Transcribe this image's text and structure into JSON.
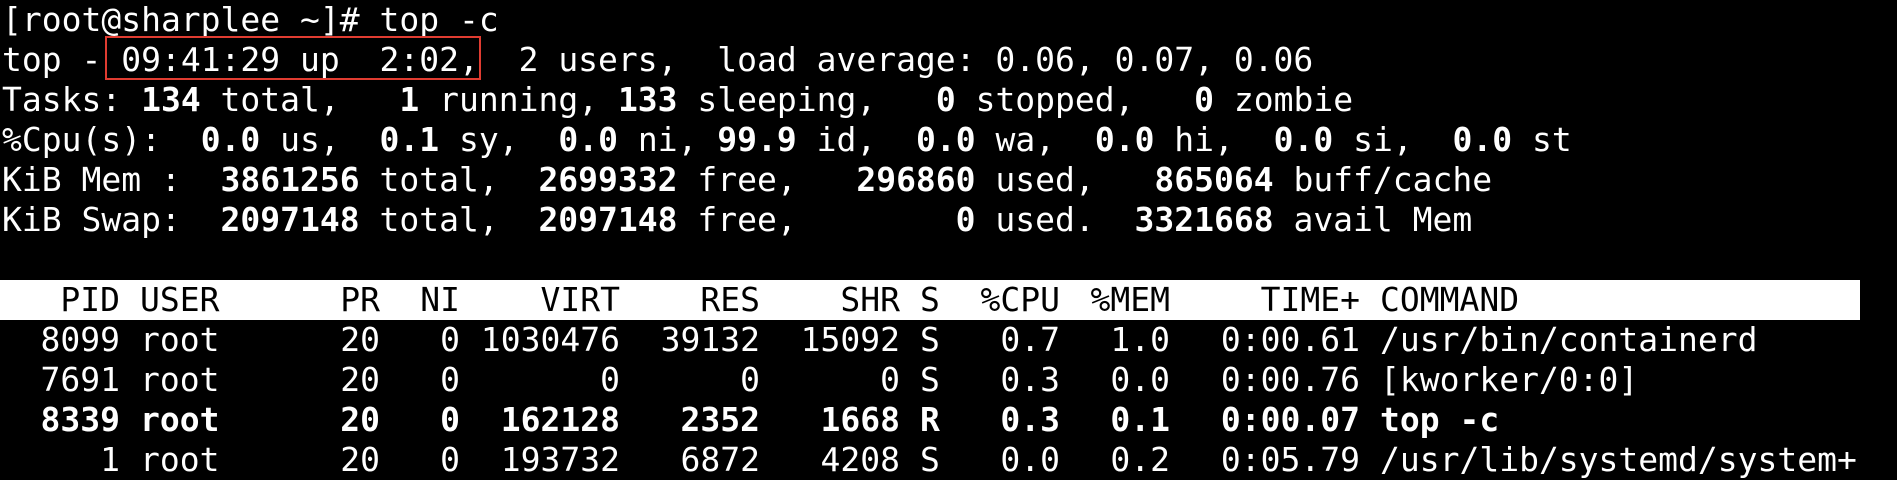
{
  "colors": {
    "background": "#000000",
    "text": "#ffffff",
    "header_bg": "#ffffff",
    "header_text": "#000000",
    "highlight": "#e03c31"
  },
  "prompt": "[root@sharplee ~]# top -c",
  "summary": {
    "top_prefix": "top - ",
    "time_uptime": "09:41:29 up  2:02,",
    "users_load": "  2 users,  load average: 0.06, 0.07, 0.06",
    "tasks": {
      "label": "Tasks: ",
      "total": "134",
      "total_label": " total,   ",
      "running": "1",
      "running_label": " running, ",
      "sleeping": "133",
      "sleeping_label": " sleeping,   ",
      "stopped": "0",
      "stopped_label": " stopped,   ",
      "zombie": "0",
      "zombie_label": " zombie"
    },
    "cpu": {
      "label": "%Cpu(s):  ",
      "us": "0.0",
      "us_label": " us,  ",
      "sy": "0.1",
      "sy_label": " sy,  ",
      "ni": "0.0",
      "ni_label": " ni, ",
      "id": "99.9",
      "id_label": " id,  ",
      "wa": "0.0",
      "wa_label": " wa,  ",
      "hi": "0.0",
      "hi_label": " hi,  ",
      "si": "0.0",
      "si_label": " si,  ",
      "st": "0.0",
      "st_label": " st"
    },
    "mem": {
      "label": "KiB Mem :  ",
      "total": "3861256",
      "total_label": " total,  ",
      "free": "2699332",
      "free_label": " free,   ",
      "used": "296860",
      "used_label": " used,   ",
      "buff": "865064",
      "buff_label": " buff/cache"
    },
    "swap": {
      "label": "KiB Swap:  ",
      "total": "2097148",
      "total_label": " total,  ",
      "free": "2097148",
      "free_label": " free,        ",
      "used": "0",
      "used_label": " used.  ",
      "avail": "3321668",
      "avail_label": " avail Mem"
    }
  },
  "columns": {
    "pid": "PID",
    "user": "USER",
    "pr": "PR",
    "ni": "NI",
    "virt": "VIRT",
    "res": "RES",
    "shr": "SHR",
    "s": "S",
    "cpu": "%CPU",
    "mem": "%MEM",
    "time": "TIME+",
    "command": "COMMAND"
  },
  "processes": [
    {
      "pid": "8099",
      "user": "root",
      "pr": "20",
      "ni": "0",
      "virt": "1030476",
      "res": "39132",
      "shr": "15092",
      "s": "S",
      "cpu": "0.7",
      "mem": "1.0",
      "time": "0:00.61",
      "command": "/usr/bin/containerd"
    },
    {
      "pid": "7691",
      "user": "root",
      "pr": "20",
      "ni": "0",
      "virt": "0",
      "res": "0",
      "shr": "0",
      "s": "S",
      "cpu": "0.3",
      "mem": "0.0",
      "time": "0:00.76",
      "command": "[kworker/0:0]"
    },
    {
      "pid": "8339",
      "user": "root",
      "pr": "20",
      "ni": "0",
      "virt": "162128",
      "res": "2352",
      "shr": "1668",
      "s": "R",
      "cpu": "0.3",
      "mem": "0.1",
      "time": "0:00.07",
      "command": "top -c"
    },
    {
      "pid": "1",
      "user": "root",
      "pr": "20",
      "ni": "0",
      "virt": "193732",
      "res": "6872",
      "shr": "4208",
      "s": "S",
      "cpu": "0.0",
      "mem": "0.2",
      "time": "0:05.79",
      "command": "/usr/lib/systemd/system+"
    }
  ]
}
